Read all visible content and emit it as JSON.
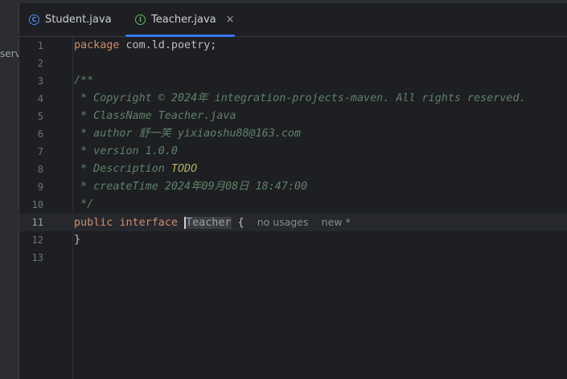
{
  "sidebar": {
    "cut_label": "serv"
  },
  "tabs": [
    {
      "label": "Student.java",
      "icon": "class-icon",
      "active": false
    },
    {
      "label": "Teacher.java",
      "icon": "interface-icon",
      "active": true,
      "close": "×"
    }
  ],
  "editor": {
    "line_numbers": [
      "1",
      "2",
      "3",
      "4",
      "5",
      "6",
      "7",
      "8",
      "9",
      "10",
      "11",
      "12",
      "13"
    ],
    "current_line": 11,
    "code": {
      "l1_kw": "package",
      "l1_rest": " com.ld.poetry;",
      "l3": "/**",
      "l4": " * Copyright © 2024年 integration-projects-maven. All rights reserved.",
      "l5": " * ClassName Teacher.java",
      "l6": " * author 舒一笑 yixiaoshu88@163.com",
      "l7": " * version 1.0.0",
      "l8_prefix": " * Description ",
      "l8_todo": "TODO",
      "l9": " * createTime 2024年09月08日 18:47:00",
      "l10": " */",
      "l11_kw1": "public",
      "l11_kw2": "interface",
      "l11_name": "Teacher",
      "l11_brace": " {",
      "l11_hint_usages": "no usages",
      "l11_hint_new": "new *",
      "l12": "}"
    }
  },
  "colors": {
    "accent": "#3574f0",
    "keyword": "#cf8e6d",
    "doc_comment": "#5f826b",
    "todo": "#b3ae60"
  }
}
